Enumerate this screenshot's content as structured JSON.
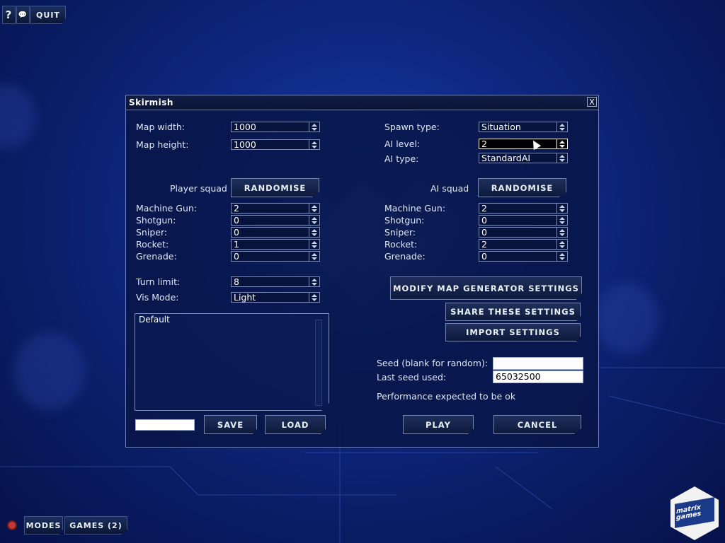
{
  "toolbar": {
    "help_icon_glyph": "?",
    "chat_icon_glyph": "💬",
    "quit_label": "QUIT"
  },
  "dialog": {
    "title": "Skirmish",
    "close_glyph": "X",
    "map_width": {
      "label": "Map width:",
      "value": "1000"
    },
    "map_height": {
      "label": "Map height:",
      "value": "1000"
    },
    "spawn_type": {
      "label": "Spawn type:",
      "value": "Situation"
    },
    "ai_level": {
      "label": "AI level:",
      "value": "2"
    },
    "ai_type": {
      "label": "AI type:",
      "value": "StandardAI"
    },
    "player_squad": {
      "label": "Player squad",
      "randomise_label": "RANDOMISE",
      "units": [
        {
          "label": "Machine Gun:",
          "value": "2"
        },
        {
          "label": "Shotgun:",
          "value": "0"
        },
        {
          "label": "Sniper:",
          "value": "0"
        },
        {
          "label": "Rocket:",
          "value": "1"
        },
        {
          "label": "Grenade:",
          "value": "0"
        }
      ]
    },
    "ai_squad": {
      "label": "AI squad",
      "randomise_label": "RANDOMISE",
      "units": [
        {
          "label": "Machine Gun:",
          "value": "2"
        },
        {
          "label": "Shotgun:",
          "value": "0"
        },
        {
          "label": "Sniper:",
          "value": "0"
        },
        {
          "label": "Rocket:",
          "value": "2"
        },
        {
          "label": "Grenade:",
          "value": "0"
        }
      ]
    },
    "turn_limit": {
      "label": "Turn limit:",
      "value": "8"
    },
    "vis_mode": {
      "label": "Vis Mode:",
      "value": "Light"
    },
    "presets": {
      "items": [
        "Default"
      ]
    },
    "preset_name_value": "",
    "save_label": "SAVE",
    "load_label": "LOAD",
    "modify_map_label": "MODIFY MAP GENERATOR SETTINGS",
    "share_label": "SHARE THESE SETTINGS",
    "import_label": "IMPORT SETTINGS",
    "seed": {
      "label": "Seed (blank for random):",
      "value": ""
    },
    "last_seed": {
      "label": "Last seed used:",
      "value": "65032500"
    },
    "performance_text": "Performance expected to be ok",
    "play_label": "PLAY",
    "cancel_label": "CANCEL"
  },
  "bottom": {
    "modes_label": "MODES",
    "games_label": "GAMES (2)"
  },
  "logo": {
    "line1": "matrix",
    "line2": "games"
  },
  "colors": {
    "background": "#0f2a86",
    "panel": "#08164a",
    "border": "#6f83b4",
    "text": "#dfe6f5"
  }
}
